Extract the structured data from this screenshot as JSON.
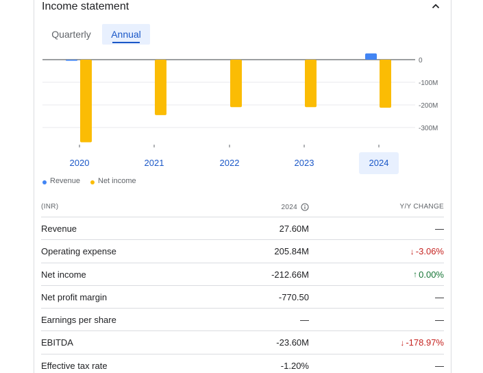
{
  "card": {
    "title": "Income statement",
    "collapse_icon": "chevron-up-icon"
  },
  "tabs": [
    {
      "label": "Quarterly",
      "selected": false
    },
    {
      "label": "Annual",
      "selected": true
    }
  ],
  "chart_data": {
    "type": "bar",
    "categories": [
      "2020",
      "2021",
      "2022",
      "2023",
      "2024"
    ],
    "selected_category": "2024",
    "series": [
      {
        "name": "Revenue",
        "color": "#4285f4",
        "values": [
          -5,
          0,
          0,
          0,
          27.6
        ]
      },
      {
        "name": "Net income",
        "color": "#fbbc04",
        "values": [
          -365,
          -245,
          -210,
          -210,
          -212.66
        ]
      }
    ],
    "yticks": [
      "0",
      "-100M",
      "-200M",
      "-300M"
    ],
    "ytick_values": [
      0,
      -100,
      -200,
      -300
    ],
    "ylim": [
      -370,
      30
    ],
    "grid": true,
    "legend_position": "bottom-left"
  },
  "legend": [
    {
      "name": "Revenue",
      "color": "#4285f4"
    },
    {
      "name": "Net income",
      "color": "#fbbc04"
    }
  ],
  "table": {
    "headers": {
      "metric": "(INR)",
      "year": "2024",
      "change": "Y/Y CHANGE"
    },
    "info_icon": "info-icon",
    "rows": [
      {
        "label": "Revenue",
        "value": "27.60M",
        "change": "—",
        "dir": "none"
      },
      {
        "label": "Operating expense",
        "value": "205.84M",
        "change": "-3.06%",
        "dir": "down"
      },
      {
        "label": "Net income",
        "value": "-212.66M",
        "change": "0.00%",
        "dir": "up"
      },
      {
        "label": "Net profit margin",
        "value": "-770.50",
        "change": "—",
        "dir": "none"
      },
      {
        "label": "Earnings per share",
        "value": "—",
        "change": "—",
        "dir": "none"
      },
      {
        "label": "EBITDA",
        "value": "-23.60M",
        "change": "-178.97%",
        "dir": "down"
      },
      {
        "label": "Effective tax rate",
        "value": "-1.20%",
        "change": "—",
        "dir": "none"
      }
    ]
  },
  "colors": {
    "accent": "#1a57c7",
    "selected_bg": "#e8f0fe",
    "negative": "#c5221f",
    "positive": "#137333"
  }
}
